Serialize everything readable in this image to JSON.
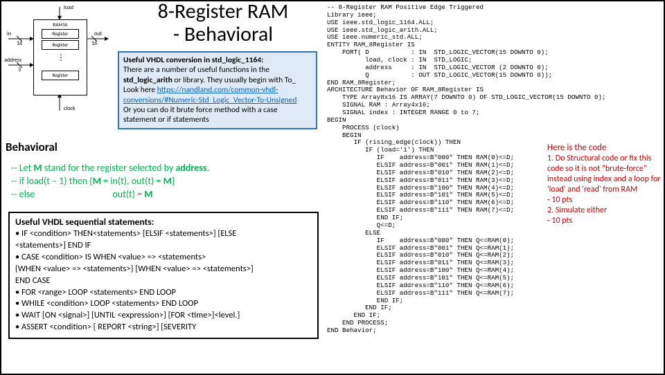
{
  "title_l1": "8-Register RAM",
  "title_l2": "- Behavioral",
  "diagram": {
    "load": "load",
    "ramtitle": "RAM16",
    "reg": "Register",
    "in": "in",
    "sixteen_a": "16",
    "out": "out",
    "sixteen_b": "16",
    "address": "address",
    "three": "3",
    "dots": "⋮",
    "clock": "clock"
  },
  "info1": {
    "l1a": "Useful VHDL conversion in std_logic_1164:",
    "l2": "There are a number of useful functions in the",
    "l3a": "std_logic_arith",
    "l3b": " or  library.  They usually begin with To_",
    "l4": "Look here ",
    "link": "https://nandland.com/common-vhdl-conversions/#Numeric-Std_Logic_Vector-To-Unsigned",
    "l5": "Or you can do it brute force method with a case statement or if statements"
  },
  "behav_head": "Behavioral",
  "behav": {
    "l1a": "-- Let ",
    "l1b": "M",
    "l1c": " stand for the register selected by ",
    "l1d": "address",
    "l1e": ".",
    "l2a": "-- if load(t – 1) then {",
    "l2b": "M",
    "l2c": " = in(t), out(t) = ",
    "l2d": "M",
    "l2e": "}",
    "l3a": "-- else",
    "l3b": "out(t) = ",
    "l3c": "M"
  },
  "info2": {
    "head": "Useful VHDL sequential statements:",
    "b1": "• IF <condition> THEN<statements> [ELSIF <statements>] [ELSE",
    "b1b": "  <statements>] END IF",
    "b2": "• CASE <condition> IS WHEN <value> => <statements>",
    "b2b": "  {WHEN <value> => <statements>} [WHEN <value> => <statements>]",
    "b2c": "  END CASE",
    "b3": "• FOR <range> LOOP <statements> END LOOP",
    "b4": "• WHILE <condition> LOOP <statements> END LOOP",
    "b5": "• WAIT [ON <signal>] [UNTIL <expression>] [FOR <time>]<level.]",
    "b6": "• ASSERT <condition> [ REPORT <string>] [SEVERITY"
  },
  "code": "-- 8-Register RAM Positive Edge Triggered\nLibrary ieee;\nUSE ieee.std_logic_1164.ALL;\nUSE ieee.std_logic_arith.ALL;\nUSE ieee.numeric_std.ALL;\nENTITY RAM_8Register IS\n    PORT( D           : IN  STD_LOGIC_VECTOR(15 DOWNTO 0);\n          load, clock : IN  STD_LOGIC;\n          address     : IN  STD_LOGIC_VECTOR (2 DOWNTO 0);\n          Q           : OUT STD_LOGIC_VECTOR(15 DOWNTO 0));\nEND RAM_8Register;\nARCHITECTURE Behavior OF RAM_8Register IS\n    TYPE Array8x16 IS ARRAY(7 DOWNTO 0) OF STD_LOGIC_VECTOR(15 DOWNTO 0);\n    SIGNAL RAM : Array4x16;\n    SIGNAL index : INTEGER RANGE 0 to 7;\nBEGIN\n    PROCESS (clock)\n    BEGIN\n       IF (rising_edge(clock)) THEN\n          IF (load='1') THEN\n             IF    address=B\"000\" THEN RAM(0)<=D;\n             ELSIF address=B\"001\" THEN RAM(1)<=D;\n             ELSIF address=B\"010\" THEN RAM(2)<=D;\n             ELSIF address=B\"011\" THEN RAM(3)<=D;\n             ELSIF address=B\"100\" THEN RAM(4)<=D;\n             ELSIF address=B\"101\" THEN RAM(5)<=D;\n             ELSIF address=B\"110\" THEN RAM(6)<=D;\n             ELSIF address=B\"111\" THEN RAM(7)<=D;\n             END IF;\n             Q<=D;\n          ELSE\n             IF    address=B\"000\" THEN Q<=RAM(0);\n             ELSIF address=B\"001\" THEN Q<=RAM(1);\n             ELSIF address=B\"010\" THEN Q<=RAM(2);\n             ELSIF address=B\"011\" THEN Q<=RAM(3);\n             ELSIF address=B\"100\" THEN Q<=RAM(4);\n             ELSIF address=B\"101\" THEN Q<=RAM(5);\n             ELSIF address=B\"110\" THEN Q<=RAM(6);\n             ELSIF address=B\"111\" THEN Q<=RAM(7);\n             END IF;\n          END IF;\n       END IF;\n    END PROCESS;\nEND Behavior;",
  "notes": {
    "head": "Here is the code",
    "n1": "1.  Do Structural code or fix this code so it is not \"brute-force\" instead using index and a loop for 'load' and 'read' from RAM",
    "n1b": "- 10 pts",
    "n2": "2. Simulate either",
    "n2b": "- 10 pts"
  }
}
